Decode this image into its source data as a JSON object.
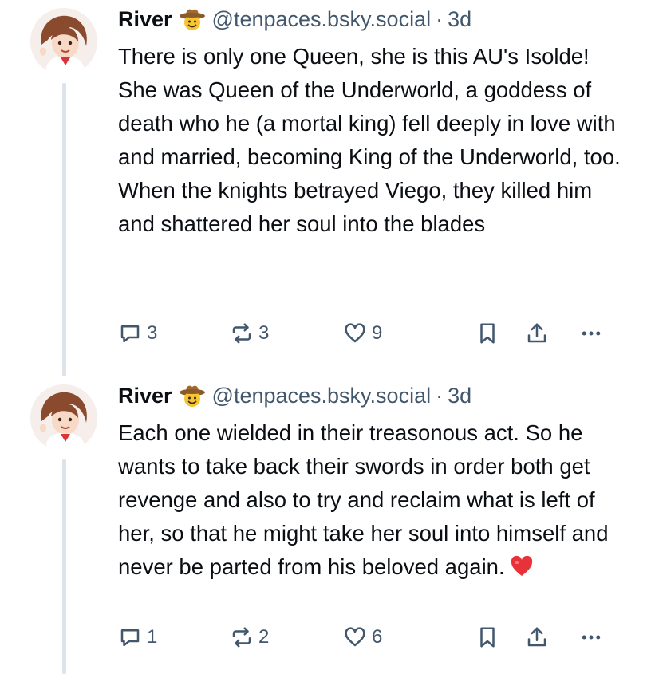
{
  "posts": [
    {
      "author": "River",
      "handle": "@tenpaces.bsky.social",
      "separator": "·",
      "time": "3d",
      "text": "There is only one Queen, she is this AU's Isolde! She was Queen of the Underworld, a goddess of death who he (a mortal king) fell deeply in love with and married, becoming King of the Underworld, too. When the knights betrayed Viego, they killed him and shattered her soul into the blades",
      "replies": "3",
      "reposts": "3",
      "likes": "9"
    },
    {
      "author": "River",
      "handle": "@tenpaces.bsky.social",
      "separator": "·",
      "time": "3d",
      "text": "Each one wielded in their treasonous act. So he wants to take back their swords in order both get revenge and also to try and reclaim what is left of her, so that he might take her soul into himself and never be parted from his beloved again.",
      "replies": "1",
      "reposts": "2",
      "likes": "6"
    }
  ],
  "icons": {
    "badge": "cowboy-emoji-icon",
    "heart": "red-heart-emoji-icon",
    "reply": "reply-icon",
    "repost": "repost-icon",
    "like": "like-icon",
    "save": "bookmark-icon",
    "share": "share-icon",
    "more": "more-icon"
  },
  "colors": {
    "text": "#0b0f14",
    "muted": "#42576c",
    "thread": "#dde3ea",
    "heart": "#e8323a"
  }
}
